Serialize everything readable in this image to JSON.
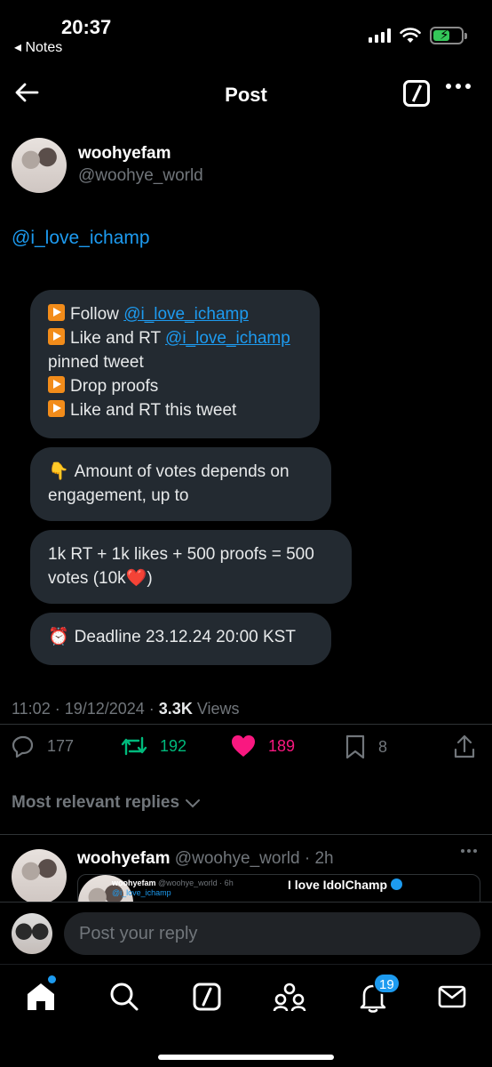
{
  "status_bar": {
    "time": "20:37",
    "back_label": "◂ Notes"
  },
  "header": {
    "title": "Post"
  },
  "post": {
    "author_name": "woohyefam",
    "author_handle": "@woohye_world",
    "mention": "@i_love_ichamp",
    "bubble1": {
      "l1_prefix": "Follow ",
      "l1_link": "@i_love_ichamp",
      "l2_prefix": "Like and RT ",
      "l2_link": "@i_love_ichamp",
      "l3": "pinned tweet",
      "l4": "Drop proofs",
      "l5": "Like and RT this tweet"
    },
    "bubble2": {
      "emoji": "👇",
      "text": "Amount of votes depends on engagement, up to"
    },
    "bubble3": {
      "text": "1k RT + 1k likes + 500 proofs = 500 votes (10k",
      "emoji": "❤️",
      "suffix": ")"
    },
    "bubble4": {
      "emoji": "⏰",
      "text": "Deadline 23.12.24 20:00 KST"
    },
    "timestamp": "11:02 · 19/12/2024 · ",
    "views_count": "3.3K",
    "views_label": " Views",
    "replies": "177",
    "reposts": "192",
    "likes": "189",
    "bookmarks": "8"
  },
  "replies_sort": {
    "label": "Most relevant replies"
  },
  "reply": {
    "author_name": "woohyefam",
    "author_handle": " @woohye_world · 2h",
    "quote_name": "woohyefam",
    "quote_handle_inline": " @woohye_world · 6h",
    "quote_handle": "@i_love_ichamp",
    "quote_title": "I love IdolChamp"
  },
  "reply_bar": {
    "placeholder": "Post your reply"
  },
  "tabbar": {
    "notifications_badge": "19"
  },
  "colors": {
    "accent": "#1d9bf0",
    "like": "#f91880",
    "repost": "#00ba7c",
    "bubble": "#232a31"
  }
}
